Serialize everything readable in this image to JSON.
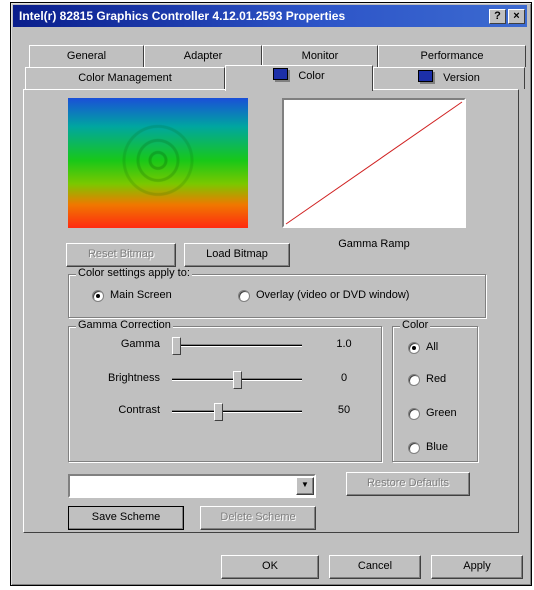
{
  "window": {
    "title": "Intel(r) 82815 Graphics Controller 4.12.01.2593 Properties",
    "help_label": "?",
    "close_label": "×"
  },
  "tabs": {
    "row1": [
      "General",
      "Adapter",
      "Monitor",
      "Performance"
    ],
    "row2": [
      "Color Management",
      "Color",
      "Version"
    ],
    "active": "Color"
  },
  "preview": {
    "gamma_ramp_label": "Gamma Ramp",
    "reset_bitmap_label": "Reset Bitmap",
    "load_bitmap_label": "Load Bitmap"
  },
  "color_settings": {
    "group_label": "Color settings apply to:",
    "options": [
      "Main Screen",
      "Overlay (video or DVD window)"
    ],
    "selected": "Main Screen"
  },
  "gamma": {
    "group_label": "Gamma Correction",
    "sliders": [
      {
        "label": "Gamma",
        "value": "1.0",
        "level": 0.0
      },
      {
        "label": "Brightness",
        "value": "0",
        "level": 0.5
      },
      {
        "label": "Contrast",
        "value": "50",
        "level": 0.35
      }
    ]
  },
  "color_channel": {
    "group_label": "Color",
    "options": [
      "All",
      "Red",
      "Green",
      "Blue"
    ],
    "selected": "All"
  },
  "scheme": {
    "combo_value": "",
    "restore_defaults_label": "Restore Defaults",
    "save_scheme_label": "Save Scheme",
    "delete_scheme_label": "Delete Scheme"
  },
  "footer": {
    "ok_label": "OK",
    "cancel_label": "Cancel",
    "apply_label": "Apply"
  }
}
